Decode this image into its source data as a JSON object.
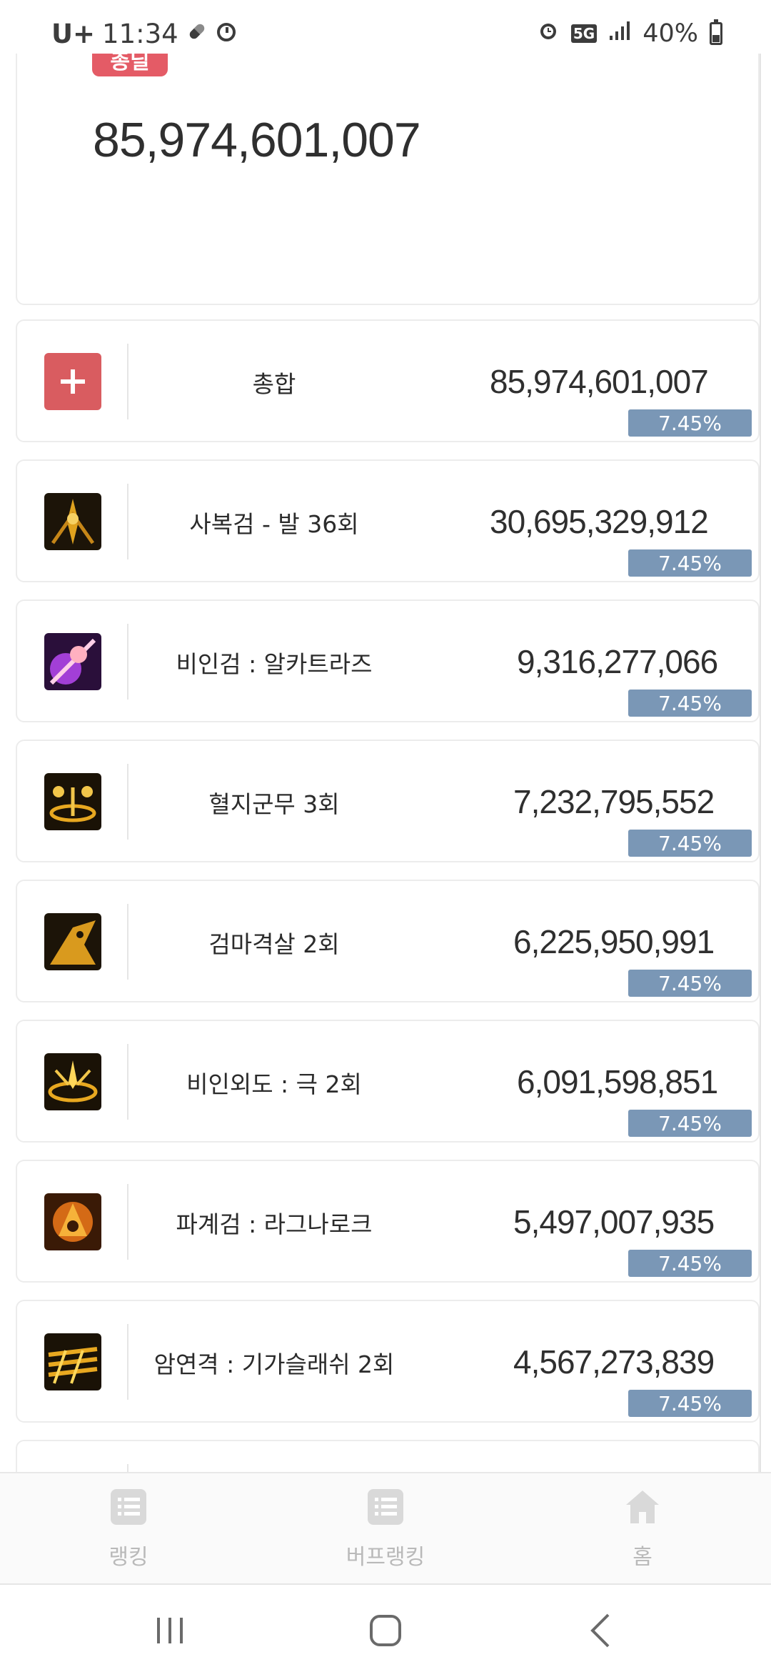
{
  "status_bar": {
    "carrier": "U+",
    "time": "11:34",
    "network": "5G",
    "battery": "40%"
  },
  "summary": {
    "badge": "총딜",
    "total": "85,974,601,007"
  },
  "rows": [
    {
      "name": "총합",
      "value": "85,974,601,007",
      "percent": "7.45%",
      "icon": "plus-icon"
    },
    {
      "name": "사복검 - 발 36회",
      "value": "30,695,329,912",
      "percent": "7.45%",
      "icon": "skill-icon"
    },
    {
      "name": "비인검 : 알카트라즈",
      "value": "9,316,277,066",
      "percent": "7.45%",
      "icon": "skill-icon"
    },
    {
      "name": "혈지군무 3회",
      "value": "7,232,795,552",
      "percent": "7.45%",
      "icon": "skill-icon"
    },
    {
      "name": "검마격살 2회",
      "value": "6,225,950,991",
      "percent": "7.45%",
      "icon": "skill-icon"
    },
    {
      "name": "비인외도 : 극 2회",
      "value": "6,091,598,851",
      "percent": "7.45%",
      "icon": "skill-icon"
    },
    {
      "name": "파계검 : 라그나로크",
      "value": "5,497,007,935",
      "percent": "7.45%",
      "icon": "skill-icon"
    },
    {
      "name": "암연격 : 기가슬래쉬 2회",
      "value": "4,567,273,839",
      "percent": "7.45%",
      "icon": "skill-icon"
    }
  ],
  "bottom_nav": {
    "ranking": "랭킹",
    "buff_ranking": "버프랭킹",
    "home": "홈"
  },
  "colors": {
    "badge": "#e45b66",
    "percent_bar": "#7a97b6",
    "plus_button": "#d95c60"
  }
}
